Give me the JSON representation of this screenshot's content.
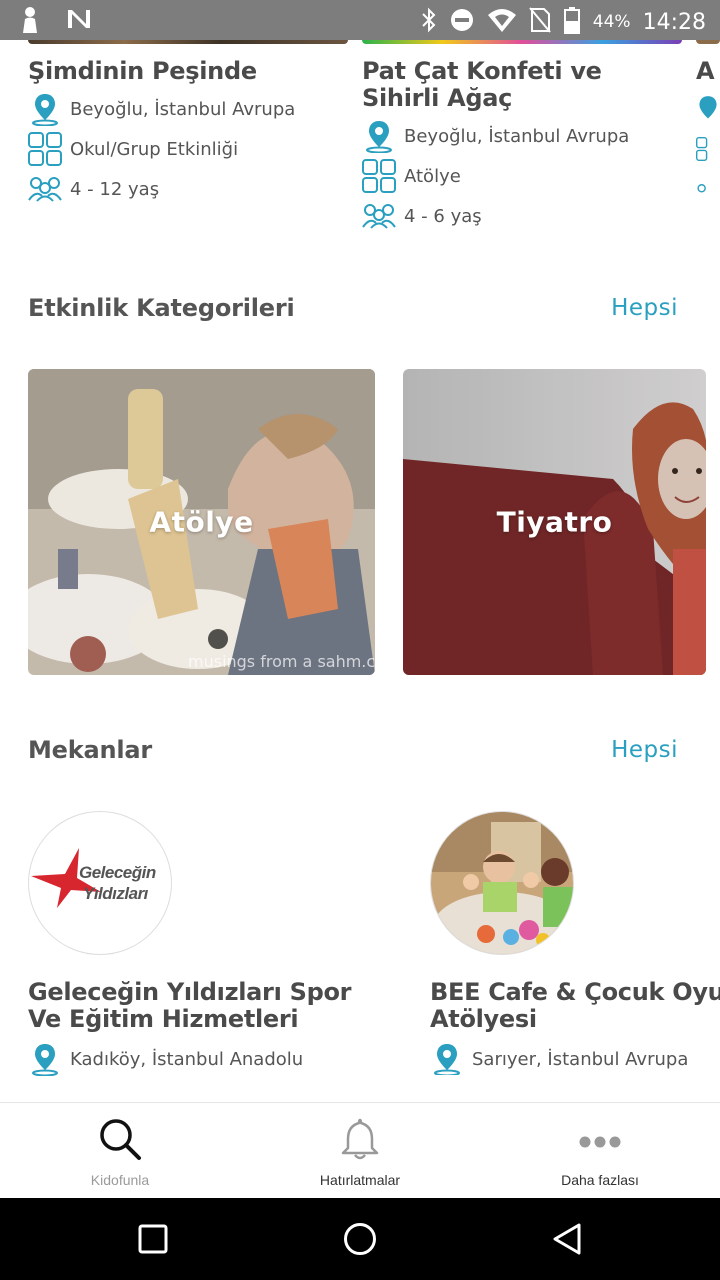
{
  "status_bar": {
    "battery_percent": "44%",
    "time": "14:28",
    "icons": [
      "person-icon",
      "n-icon",
      "bluetooth-icon",
      "do-not-disturb-icon",
      "wifi-icon",
      "no-sim-icon",
      "battery-icon"
    ]
  },
  "events": [
    {
      "title": "Şimdinin Peşinde",
      "location": "Beyoğlu, İstanbul Avrupa",
      "type": "Okul/Grup Etkinliği",
      "age": "4 - 12 yaş"
    },
    {
      "title": "Pat Çat Konfeti ve Sihirli Ağaç",
      "location": "Beyoğlu, İstanbul Avrupa",
      "type": "Atölye",
      "age": "4 - 6 yaş"
    },
    {
      "title": "A"
    }
  ],
  "categories_section": {
    "title": "Etkinlik Kategorileri",
    "see_all": "Hepsi",
    "items": [
      {
        "label": "Atölye",
        "watermark": "musings from a sahm.com"
      },
      {
        "label": "Tiyatro"
      }
    ]
  },
  "venues_section": {
    "title": "Mekanlar",
    "see_all": "Hepsi",
    "items": [
      {
        "name": "Geleceğin Yıldızları Spor Ve Eğitim Hizmetleri",
        "logo_text_line1": "Geleceğin",
        "logo_text_line2": "Yıldızları",
        "location": "Kadıköy, İstanbul Anadolu"
      },
      {
        "name": "BEE Cafe & Çocuk Oyun Atölyesi",
        "location": "Sarıyer, İstanbul Avrupa"
      }
    ]
  },
  "bottom_nav": {
    "items": [
      {
        "label": "Kidofunla",
        "icon": "search-icon",
        "active": true
      },
      {
        "label": "Hatırlatmalar",
        "icon": "bell-icon",
        "active": false
      },
      {
        "label": "Daha fazlası",
        "icon": "more-icon",
        "active": false
      }
    ]
  },
  "colors": {
    "accent": "#2a9fc0",
    "title_text": "#4a4a4a",
    "body_text": "#555555",
    "inactive_nav": "#999999",
    "status_bar": "#7d7d7d"
  }
}
